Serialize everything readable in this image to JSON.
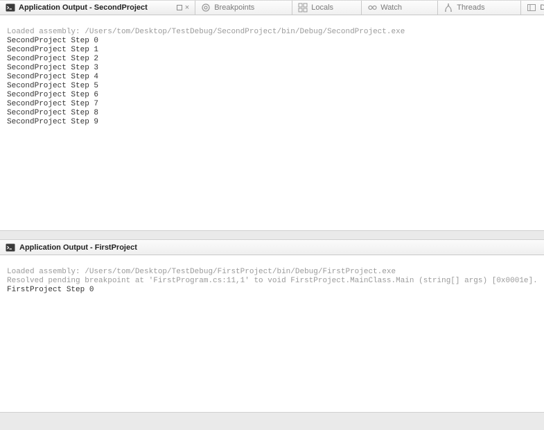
{
  "tabs": [
    {
      "label": "Application Output - SecondProject",
      "active": true
    },
    {
      "label": "Breakpoints"
    },
    {
      "label": "Locals"
    },
    {
      "label": "Watch"
    },
    {
      "label": "Threads"
    },
    {
      "label": "De"
    }
  ],
  "top_output": {
    "loaded": "Loaded assembly: /Users/tom/Desktop/TestDebug/SecondProject/bin/Debug/SecondProject.exe",
    "lines": [
      "SecondProject Step 0",
      "SecondProject Step 1",
      "SecondProject Step 2",
      "SecondProject Step 3",
      "SecondProject Step 4",
      "SecondProject Step 5",
      "SecondProject Step 6",
      "SecondProject Step 7",
      "SecondProject Step 8",
      "SecondProject Step 9"
    ]
  },
  "bottom_header": "Application Output - FirstProject",
  "bottom_output": {
    "loaded": "Loaded assembly: /Users/tom/Desktop/TestDebug/FirstProject/bin/Debug/FirstProject.exe",
    "resolved": "Resolved pending breakpoint at 'FirstProgram.cs:11,1' to void FirstProject.MainClass.Main (string[] args) [0x0001e].",
    "lines": [
      "FirstProject Step 0"
    ]
  }
}
